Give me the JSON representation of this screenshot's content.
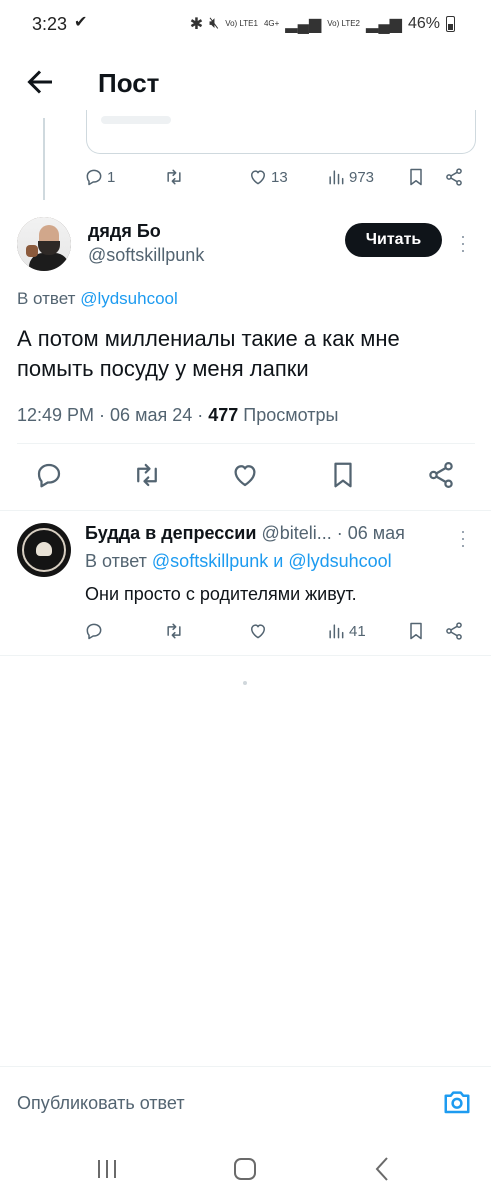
{
  "status_bar": {
    "time": "3:23",
    "check": "✔",
    "network_1": "Vo) LTE1",
    "network_2": "4G+",
    "network_3": "Vo) LTE2",
    "battery": "46%"
  },
  "header": {
    "title": "Пост"
  },
  "prev_tweet_actions": {
    "replies": "1",
    "retweets": "",
    "likes": "13",
    "views": "973"
  },
  "main_tweet": {
    "name": "дядя Бо",
    "handle": "@softskillpunk",
    "follow_label": "Читать",
    "reply_to_prefix": "В ответ",
    "reply_to_handle": "@lydsuhcool",
    "text": "А потом миллениалы такие а как мне помыть посуду у меня лапки",
    "time": "12:49 PM",
    "date": "06 мая 24",
    "views_count": "477",
    "views_label": "Просмотры"
  },
  "reply_tweet": {
    "name": "Будда в депрессии",
    "handle": "@biteli...",
    "date": "· 06 мая",
    "reply_to_prefix": "В ответ",
    "reply_to_handle_1": "@softskillpunk",
    "reply_to_and": "и",
    "reply_to_handle_2": "@lydsuhcool",
    "text": "Они просто с родителями живут.",
    "views": "41"
  },
  "compose": {
    "placeholder": "Опубликовать ответ"
  },
  "colors": {
    "accent": "#1d9bf0",
    "text": "#0f1419",
    "muted": "#536471",
    "divider": "#eff3f4"
  }
}
